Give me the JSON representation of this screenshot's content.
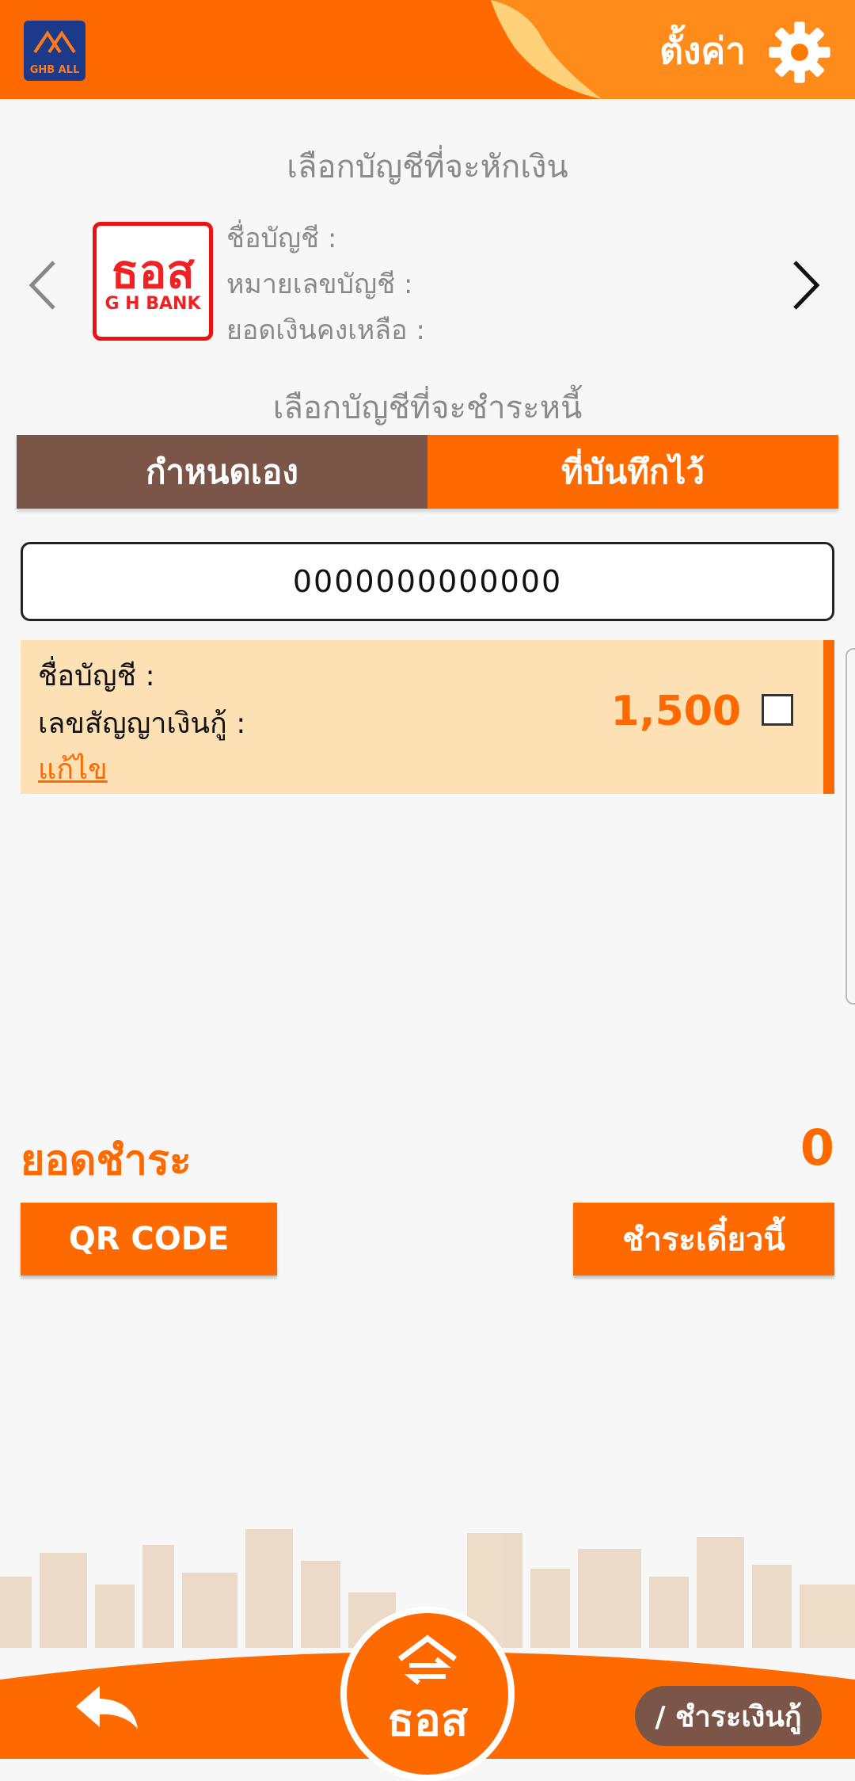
{
  "header": {
    "app_logo_text": "GHB ALL",
    "settings_label": "ตั้งค่า"
  },
  "debit_section": {
    "title": "เลือกบัญชีที่จะหักเงิน",
    "bank_logo_main": "ธอส",
    "bank_logo_sub": "G H BANK",
    "account_name_label": "ชื่อบัญชี :",
    "account_number_label": "หมายเลขบัญชี :",
    "balance_label": "ยอดเงินคงเหลือ :"
  },
  "payee_section": {
    "title": "เลือกบัญชีที่จะชำระหนี้",
    "tabs": [
      {
        "label": "กำหนดเอง"
      },
      {
        "label": "ที่บันทึกไว้"
      }
    ],
    "account_input_value": "0000000000000",
    "loan_card": {
      "account_name_label": "ชื่อบัญชี :",
      "contract_label": "เลขสัญญาเงินกู้ :",
      "edit_label": "แก้ไข",
      "amount": "1,500"
    }
  },
  "payment": {
    "total_label": "ยอดชำระ",
    "total_value": "0",
    "qr_button": "QR CODE",
    "pay_now_button": "ชำระเดี๋ยวนี้"
  },
  "bottom_nav": {
    "home_text": "ธอส",
    "breadcrumb": "/ ชำระเงินกู้"
  },
  "colors": {
    "primary": "#ff6a00",
    "tab_inactive": "#7a5548",
    "card_bg": "#fde0b4"
  }
}
